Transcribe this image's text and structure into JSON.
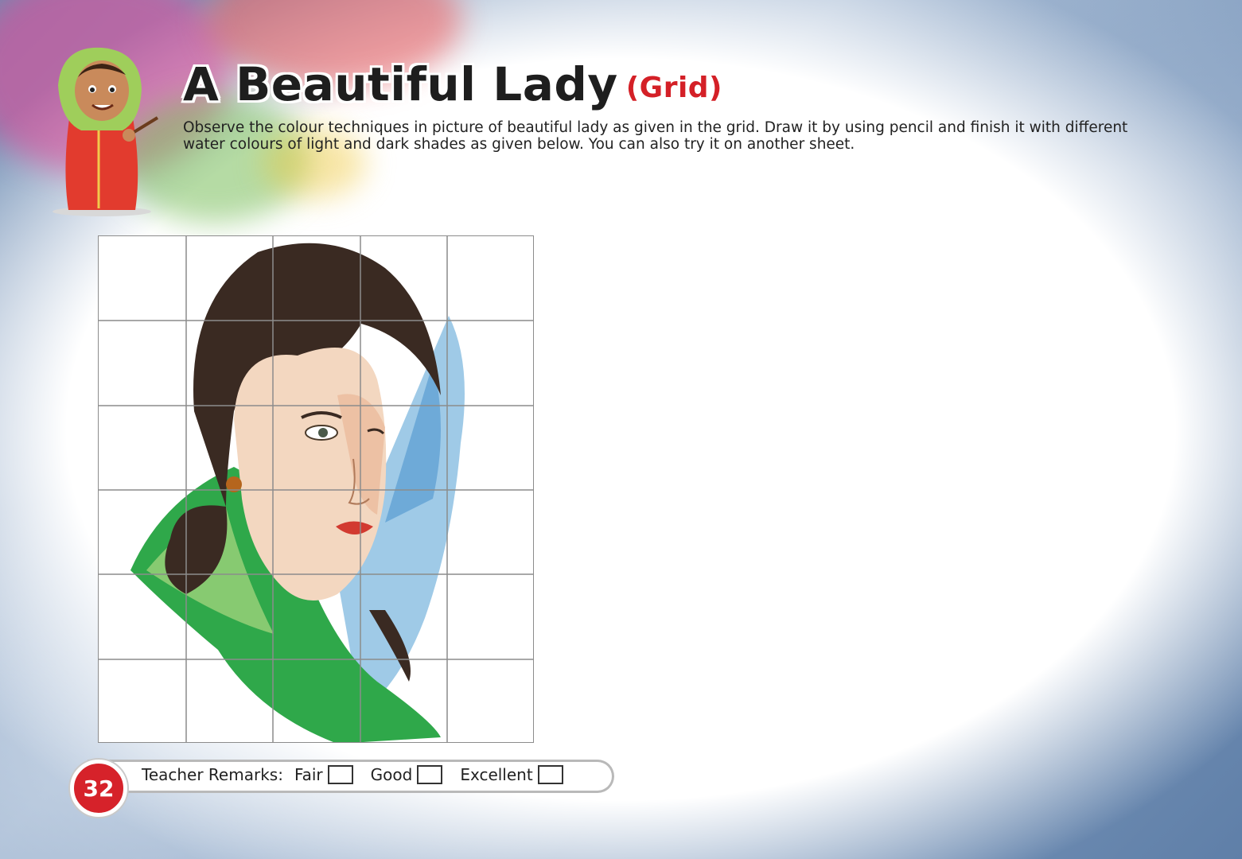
{
  "header": {
    "title": "A Beautiful Lady",
    "subtitle": "(Grid)",
    "instructions": "Observe the colour techniques in picture of beautiful lady as given in the grid. Draw it by using pencil and finish it with different water colours of light and dark shades as given below. You can also try it on another sheet."
  },
  "grid": {
    "columns": 5,
    "rows": 6
  },
  "footer": {
    "page_number": "32",
    "remarks_label": "Teacher Remarks:",
    "options": [
      "Fair",
      "Good",
      "Excellent"
    ]
  },
  "colors": {
    "title_accent": "#d42027",
    "page_badge": "#d6222a",
    "border_wash": "#7f9bbd"
  }
}
